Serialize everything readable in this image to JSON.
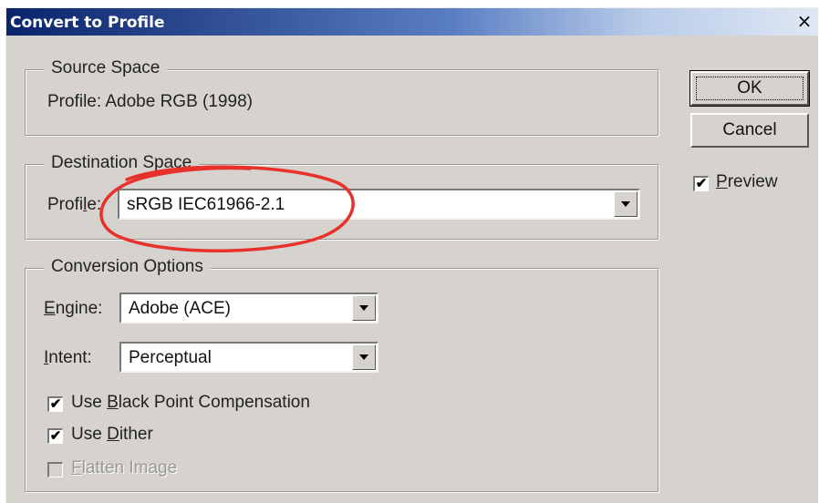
{
  "window": {
    "title": "Convert to Profile",
    "close_glyph": "×"
  },
  "source_space": {
    "legend": "Source Space",
    "profile_text": "Profile:  Adobe RGB (1998)"
  },
  "destination_space": {
    "legend": "Destination Space",
    "profile_label_a": "Profi",
    "profile_label_u": "l",
    "profile_label_b": "e:",
    "profile_value": "sRGB IEC61966-2.1"
  },
  "conversion_options": {
    "legend": "Conversion Options",
    "engine_label_u": "E",
    "engine_label_rest": "ngine:",
    "engine_value": "Adobe (ACE)",
    "intent_label_u": "I",
    "intent_label_rest": "ntent:",
    "intent_value": "Perceptual",
    "black_point": {
      "label_a": "Use ",
      "label_u": "B",
      "label_b": "lack Point Compensation",
      "checked": true
    },
    "dither": {
      "label_a": "Use ",
      "label_u": "D",
      "label_b": "ither",
      "checked": true
    },
    "flatten": {
      "label_u": "F",
      "label_b": "latten Image",
      "checked": false,
      "disabled": true
    }
  },
  "buttons": {
    "ok": "OK",
    "cancel": "Cancel"
  },
  "preview": {
    "label_u": "P",
    "label_b": "review",
    "checked": true
  },
  "check_glyph": "✔",
  "colors": {
    "titlebar_start": "#0a246a",
    "face": "#d6d3ce",
    "annotation": "#e8312a"
  }
}
